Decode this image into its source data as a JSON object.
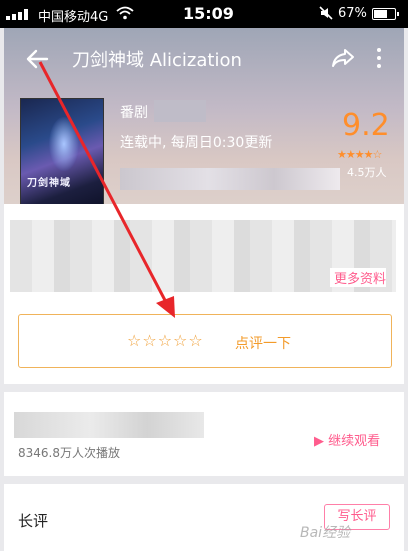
{
  "status_bar": {
    "carrier": "中国移动4G",
    "time": "15:09",
    "battery": "67%",
    "battery_level": 0.67
  },
  "header": {
    "title": "刀剑神域 Alicization"
  },
  "info": {
    "type": "番剧",
    "separator": "|",
    "status": "连载中, 每周日0:30更新",
    "score": "9.2",
    "stars": "★★★★☆",
    "rating_count": "4.5万人"
  },
  "poster": {
    "logo": "刀剑神域"
  },
  "description": {
    "more_label": "更多资料"
  },
  "rate": {
    "stars": "☆☆☆☆☆",
    "label": "点评一下"
  },
  "watch": {
    "play_count": "8346.8万人次播放",
    "continue_label": "▶ 继续观看"
  },
  "reviews": {
    "title": "长评",
    "write_label": "写长评"
  },
  "watermark": "Bai经验",
  "colors": {
    "accent_pink": "#ff5c8d",
    "score_orange": "#ff8e2b",
    "arrow_red": "#e8262a"
  }
}
